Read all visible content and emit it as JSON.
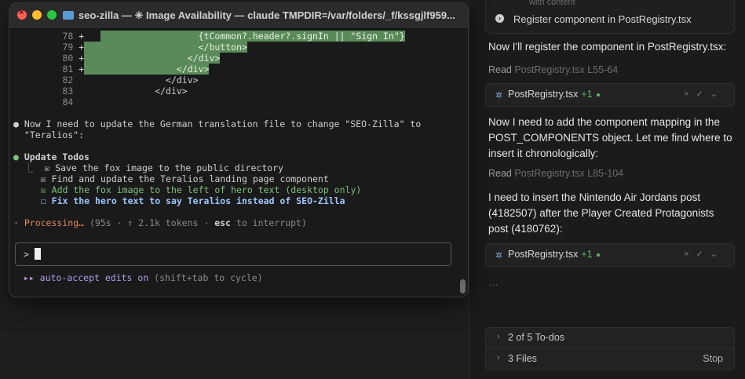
{
  "terminal": {
    "title": "seo-zilla — ✳ Image Availability — claude TMPDIR=/var/folders/_f/kssgjlf959...",
    "diff": [
      {
        "num": "78",
        "sign": "+",
        "code": "{tCommon?.header?.signIn || \"Sign In\"}"
      },
      {
        "num": "79",
        "sign": "+",
        "code": "</button>"
      },
      {
        "num": "80",
        "sign": "+",
        "code": "</div>"
      },
      {
        "num": "81",
        "sign": "+",
        "code": "</div>"
      },
      {
        "num": "82",
        "sign": "",
        "code": "</div>"
      },
      {
        "num": "83",
        "sign": "",
        "code": "</div>"
      },
      {
        "num": "84",
        "sign": "",
        "code": ""
      }
    ],
    "message_line1": "● Now I need to update the German translation file to change \"SEO-Zilla\" to",
    "message_line2": "  \"Teralios\":",
    "todos_heading": "Update Todos",
    "todos": [
      {
        "mark": "☒",
        "text": "Save the fox image to the public directory"
      },
      {
        "mark": "☒",
        "text": "Find and update the Teralios landing page component"
      },
      {
        "mark": "☒",
        "text": "Add the fox image to the left of hero text (desktop only)"
      },
      {
        "mark": "☐",
        "text": "Fix the hero text to say Teralios instead of SEO-Zilla"
      }
    ],
    "processing_label": "· Processing…",
    "processing_stats": " (95s · ↑ 2.1k tokens · ",
    "processing_key": "esc",
    "processing_tail": " to interrupt)",
    "prompt": ">",
    "auto_accept": "▸▸ auto-accept edits on",
    "auto_accept_hint": " (shift+tab to cycle)"
  },
  "chat": {
    "top_hint": "with content",
    "top_item": "Register component in PostRegistry.tsx",
    "msg1": "Now I'll register the component in PostRegistry.tsx:",
    "read1_label": "Read",
    "read1_file": "PostRegistry.tsx L55-64",
    "chip1": {
      "file": "PostRegistry.tsx",
      "delta": "+1"
    },
    "msg2": "Now I need to add the component mapping in the POST_COMPONENTS object. Let me find where to insert it chronologically:",
    "read2_label": "Read",
    "read2_file": "PostRegistry.tsx L85-104",
    "msg3": "I need to insert the Nintendo Air Jordans post (4182507) after the Player Created Protagonists post (4180762):",
    "chip2": {
      "file": "PostRegistry.tsx",
      "delta": "+1"
    },
    "ellipsis": "…",
    "todos_summary": "2 of 5 To-dos",
    "files_summary": "3 Files",
    "stop_label": "Stop"
  }
}
